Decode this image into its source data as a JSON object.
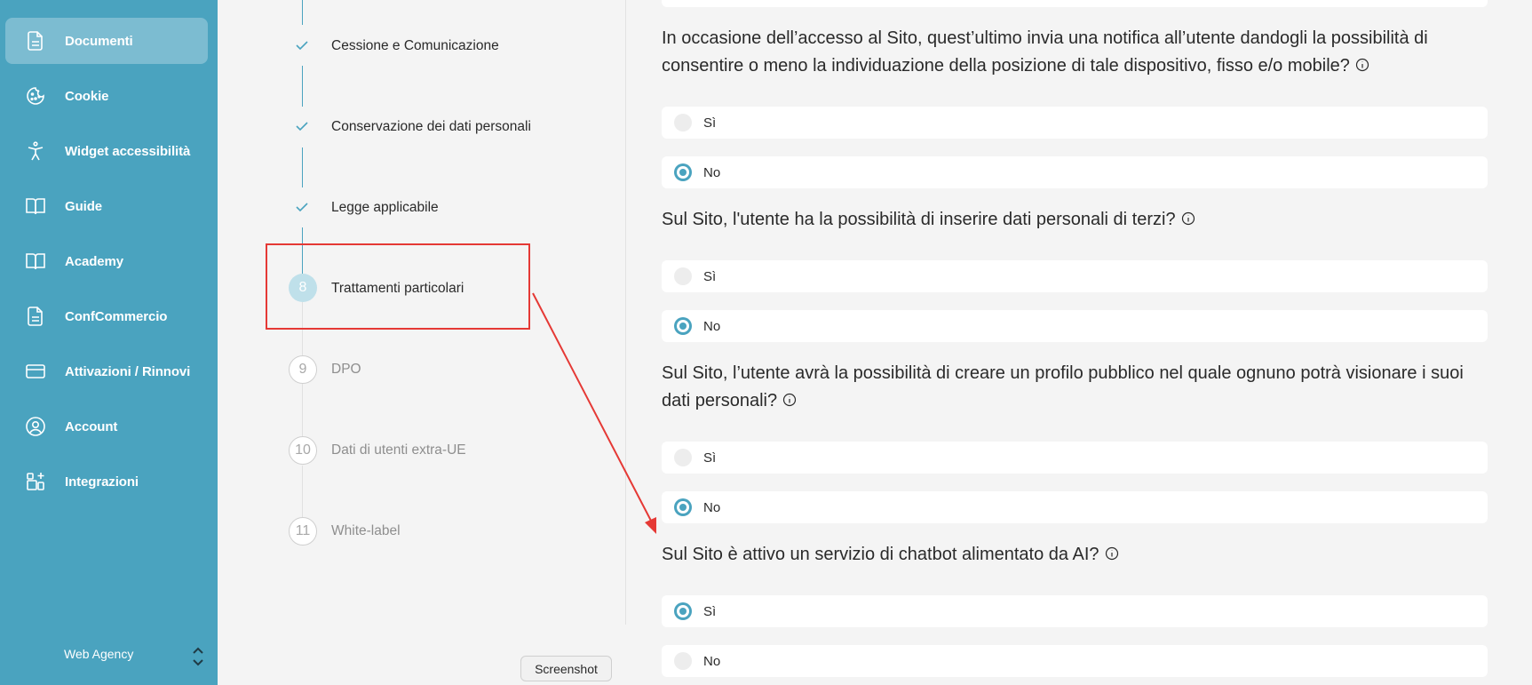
{
  "sidebar": {
    "items": [
      {
        "label": "Documenti",
        "icon": "document-icon"
      },
      {
        "label": "Cookie",
        "icon": "cookie-icon"
      },
      {
        "label": "Widget accessibilità",
        "icon": "accessibility-icon"
      },
      {
        "label": "Guide",
        "icon": "book-icon"
      },
      {
        "label": "Academy",
        "icon": "book-icon"
      },
      {
        "label": "ConfCommercio",
        "icon": "document-icon"
      },
      {
        "label": "Attivazioni / Rinnovi",
        "icon": "credit-card-icon"
      },
      {
        "label": "Account",
        "icon": "user-icon"
      },
      {
        "label": "Integrazioni",
        "icon": "grid-plus-icon"
      }
    ],
    "active_index": 0,
    "organization": "Web Agency"
  },
  "steps": [
    {
      "label": "Cessione e Comunicazione",
      "status": "done"
    },
    {
      "label": "Conservazione dei dati personali",
      "status": "done"
    },
    {
      "label": "Legge applicabile",
      "status": "done"
    },
    {
      "number": "8",
      "label": "Trattamenti particolari",
      "status": "active"
    },
    {
      "number": "9",
      "label": "DPO",
      "status": "todo"
    },
    {
      "number": "10",
      "label": "Dati di utenti extra-UE",
      "status": "todo"
    },
    {
      "number": "11",
      "label": "White-label",
      "status": "todo"
    }
  ],
  "questions": [
    {
      "text": "In occasione dell’accesso al Sito, quest’ultimo invia una notifica all’utente dandogli la possibilità di consentire o meno la individuazione della posizione di tale dispositivo, fisso e/o mobile?",
      "options": [
        "Sì",
        "No"
      ],
      "selected": "No"
    },
    {
      "text": "Sul Sito, l'utente ha la possibilità di inserire dati personali di terzi?",
      "options": [
        "Sì",
        "No"
      ],
      "selected": "No"
    },
    {
      "text": "Sul Sito, l’utente avrà la possibilità di creare un profilo pubblico nel quale ognuno potrà visionare i suoi dati personali?",
      "options": [
        "Sì",
        "No"
      ],
      "selected": "No"
    },
    {
      "text": "Sul Sito è attivo un servizio di chatbot alimentato da AI?",
      "options": [
        "Sì",
        "No"
      ],
      "selected": "Sì"
    }
  ],
  "tooltip": "Screenshot",
  "colors": {
    "accent": "#4aa3bf",
    "annotation": "#e53935"
  }
}
